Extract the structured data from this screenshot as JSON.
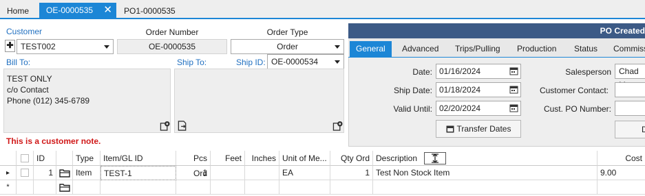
{
  "tabs": [
    {
      "label": "Home"
    },
    {
      "label": "OE-0000535"
    },
    {
      "label": "PO1-0000535"
    }
  ],
  "tab_close": "✕",
  "customer": {
    "label": "Customer",
    "value": "TEST002",
    "add_glyph": "✚"
  },
  "order_number": {
    "label": "Order Number",
    "value": "OE-0000535"
  },
  "order_type": {
    "label": "Order Type",
    "value": "Order"
  },
  "bill_to": {
    "label": "Bill To:",
    "lines": [
      "TEST ONLY",
      "c/o Contact",
      "Phone (012) 345-6789"
    ]
  },
  "ship_to": {
    "label": "Ship To:"
  },
  "ship_id": {
    "label": "Ship ID:",
    "value": "OE-0000534"
  },
  "customer_note": "This is a customer note.",
  "status_header": "PO Created",
  "sub_tabs": [
    "General",
    "Advanced",
    "Trips/Pulling",
    "Production",
    "Status",
    "Commiss"
  ],
  "general": {
    "date_label": "Date:",
    "date_value": "01/16/2024",
    "ship_date_label": "Ship Date:",
    "ship_date_value": "01/18/2024",
    "valid_until_label": "Valid Until:",
    "valid_until_value": "02/20/2024",
    "transfer_dates_label": "Transfer Dates",
    "salesperson_label": "Salesperson",
    "salesperson_value": "Chad M",
    "customer_contact_label": "Customer Contact:",
    "cust_po_label": "Cust. PO Number:",
    "cut_button_label": "D"
  },
  "grid": {
    "columns": [
      "ID",
      "Type",
      "Item/GL ID",
      "Pcs Ord",
      "Feet",
      "Inches",
      "Unit of Me...",
      "Qty Ord",
      "Description",
      "Cost"
    ],
    "rows": [
      {
        "id": "1",
        "type": "Item",
        "item": "TEST-1",
        "pcs": "1",
        "feet": "",
        "inches": "",
        "uom": "EA",
        "qty": "1",
        "description": "Test Non Stock Item",
        "cost": "9.00"
      }
    ],
    "new_row_marker": "*",
    "current_row_marker": "▸"
  },
  "colors": {
    "accent": "#1c86d6",
    "header_bar": "#3c5a86",
    "note_red": "#d01818",
    "label_blue": "#1f6fc0"
  },
  "icons": [
    "add-icon",
    "close-icon",
    "map-pin-icon",
    "copy-address-icon",
    "calendar-icon",
    "folder-icon",
    "column-autofit-icon"
  ]
}
